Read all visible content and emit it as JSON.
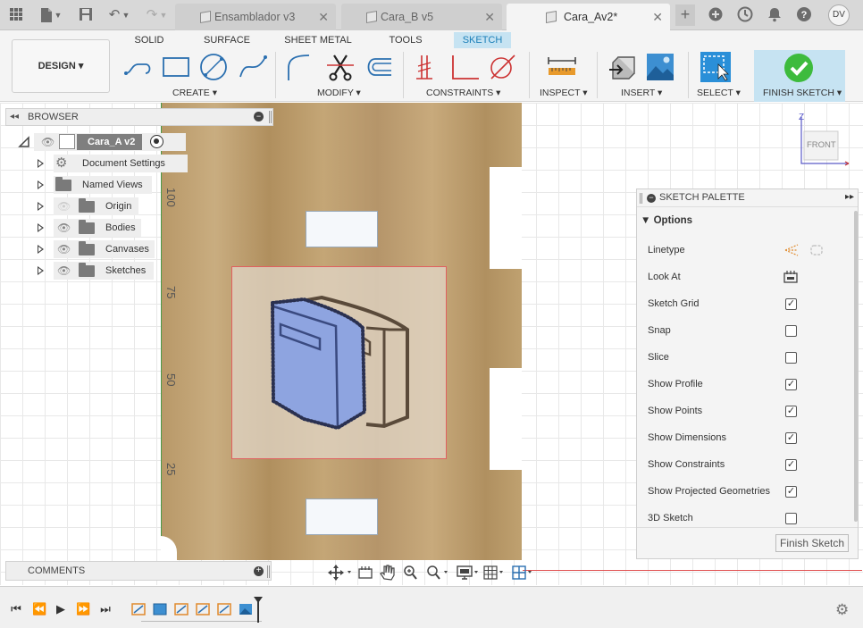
{
  "titlebar": {
    "tabs": [
      {
        "label": "Ensamblador v3"
      },
      {
        "label": "Cara_B v5"
      },
      {
        "label": "Cara_Av2*"
      }
    ],
    "user_initials": "DV",
    "icons": [
      "grid-menu-icon",
      "file-icon",
      "save-icon",
      "undo-icon",
      "redo-icon",
      "new-tab-icon",
      "extensions-icon",
      "job-status-icon",
      "notifications-icon",
      "help-icon"
    ]
  },
  "ribbon": {
    "workspace": "DESIGN ▾",
    "tabs": [
      "SOLID",
      "SURFACE",
      "SHEET METAL",
      "TOOLS",
      "SKETCH"
    ],
    "active_tab": "SKETCH",
    "groups": [
      "CREATE ▾",
      "MODIFY ▾",
      "CONSTRAINTS ▾",
      "INSPECT ▾",
      "INSERT ▾",
      "SELECT ▾",
      "FINISH SKETCH ▾"
    ],
    "accent": "#1b7fb8",
    "finish_color": "#3dbb3d"
  },
  "browser": {
    "title": "BROWSER",
    "root": "Cara_A v2",
    "items": [
      {
        "label": "Document Settings",
        "icon": "gear-icon"
      },
      {
        "label": "Named Views",
        "icon": "folder-icon"
      },
      {
        "label": "Origin",
        "icon": "folder-icon"
      },
      {
        "label": "Bodies",
        "icon": "folder-icon"
      },
      {
        "label": "Canvases",
        "icon": "folder-icon"
      },
      {
        "label": "Sketches",
        "icon": "folder-icon"
      }
    ]
  },
  "comments": {
    "title": "COMMENTS"
  },
  "canvas": {
    "axis_labels": [
      "100",
      "75",
      "50",
      "25"
    ],
    "viewcube_face": "FRONT",
    "viewcube_axis": "Z"
  },
  "palette": {
    "title": "SKETCH PALETTE",
    "section": "Options",
    "rows": [
      {
        "label": "Linetype",
        "type": "icons"
      },
      {
        "label": "Look At",
        "type": "icon"
      },
      {
        "label": "Sketch Grid",
        "checked": true
      },
      {
        "label": "Snap",
        "checked": false
      },
      {
        "label": "Slice",
        "checked": false
      },
      {
        "label": "Show Profile",
        "checked": true
      },
      {
        "label": "Show Points",
        "checked": true
      },
      {
        "label": "Show Dimensions",
        "checked": true
      },
      {
        "label": "Show Constraints",
        "checked": true
      },
      {
        "label": "Show Projected Geometries",
        "checked": true
      },
      {
        "label": "3D Sketch",
        "checked": false
      }
    ],
    "finish_button": "Finish Sketch"
  },
  "viewbar": {
    "icons": [
      "orbit-icon",
      "look-at-icon",
      "pan-icon",
      "zoom-icon",
      "fit-icon",
      "display-settings-icon",
      "grid-settings-icon",
      "viewports-icon"
    ]
  },
  "timeline": {
    "controls": [
      "first-icon",
      "prev-icon",
      "play-icon",
      "next-icon",
      "last-icon"
    ],
    "features": [
      "sketch",
      "body",
      "sketch",
      "sketch",
      "sketch",
      "canvas"
    ]
  }
}
